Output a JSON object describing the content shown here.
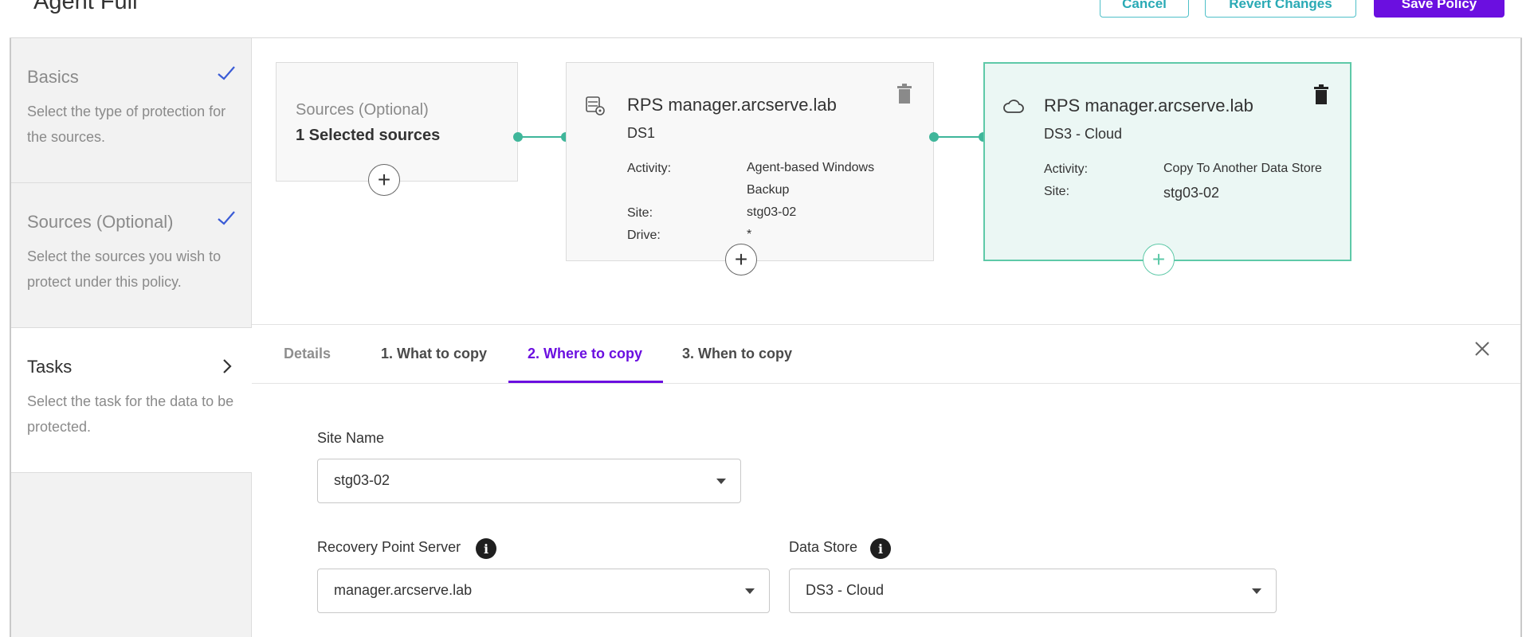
{
  "header": {
    "title": "Agent Full",
    "cancel_label": "Cancel",
    "revert_label": "Revert Changes",
    "save_label": "Save Policy"
  },
  "steps": [
    {
      "title": "Basics",
      "description": "Select the type of protection for the sources.",
      "status": "checkmark-icon"
    },
    {
      "title": "Sources (Optional)",
      "description": "Select the sources you wish to protect under this policy.",
      "status": "checkmark-icon"
    },
    {
      "title": "Tasks",
      "description": "Select the task for the data to be protected.",
      "status": "chevron-right-icon"
    }
  ],
  "flow": {
    "source_card": {
      "label": "Sources (Optional)",
      "value": "1 Selected sources"
    },
    "task_cards": [
      {
        "title": "RPS manager.arcserve.lab",
        "datastore": "DS1",
        "icon": "server-disk-icon",
        "fields": [
          {
            "label": "Activity:",
            "value": "Agent-based Windows Backup"
          },
          {
            "label": "Site:",
            "value": "stg03-02"
          },
          {
            "label": "Drive:",
            "value": "*"
          }
        ]
      },
      {
        "title": "RPS manager.arcserve.lab",
        "datastore": "DS3 - Cloud",
        "icon": "cloud-icon",
        "selected": true,
        "fields": [
          {
            "label": "Activity:",
            "value": "Copy To Another Data Store"
          },
          {
            "label": "Site:",
            "value": "stg03-02"
          }
        ]
      }
    ]
  },
  "tabs": [
    {
      "label": "Details",
      "active": false
    },
    {
      "label": "1. What to copy",
      "active": false
    },
    {
      "label": "2. Where to copy",
      "active": true
    },
    {
      "label": "3. When to copy",
      "active": false
    }
  ],
  "form": {
    "site_name": {
      "label": "Site Name",
      "value": "stg03-02"
    },
    "rps": {
      "label": "Recovery Point Server",
      "value": "manager.arcserve.lab"
    },
    "data_store": {
      "label": "Data Store",
      "value": "DS3 - Cloud"
    }
  },
  "colors": {
    "accent": "#6b0fe0",
    "teal": "#2aaab5",
    "connector": "#3fb69a",
    "selected_bg": "#ebf7f4",
    "selected_border": "#5ec9a8"
  }
}
